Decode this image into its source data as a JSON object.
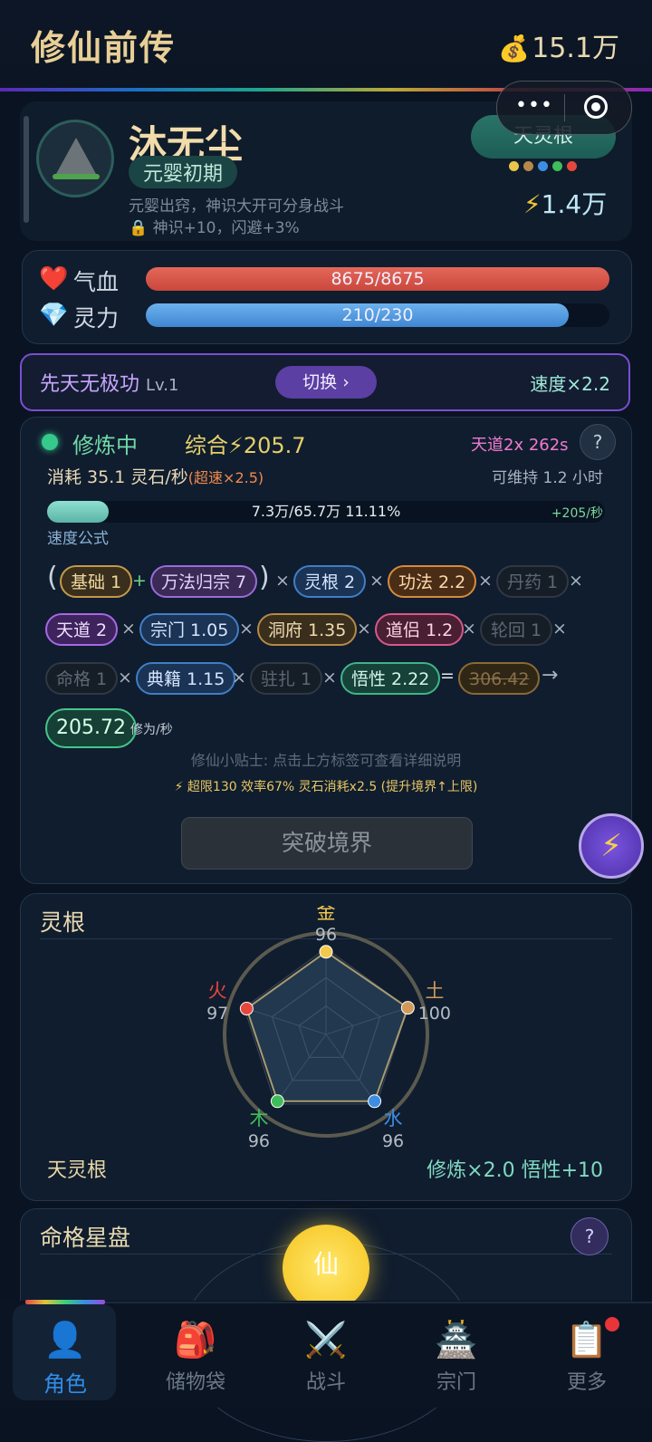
{
  "header": {
    "title": "修仙前传",
    "coins_icon": "money-bag-icon",
    "coins": "15.1万"
  },
  "profile": {
    "name": "沐无尘",
    "realm": "元婴初期",
    "realm_desc": "元婴出窍，神识大开可分身战斗",
    "realm_bonus": "神识+10，闪避+3%",
    "root_button": "天灵根",
    "root_dot_colors": [
      "#e8c64a",
      "#b7884a",
      "#3d8de3",
      "#3fbd5a",
      "#e5473d"
    ],
    "power": "1.4万"
  },
  "stats": {
    "hp_label": "气血",
    "hp_text": "8675/8675",
    "hp_fraction": 1.0,
    "mp_label": "灵力",
    "mp_text": "210/230",
    "mp_fraction": 0.913
  },
  "technique": {
    "name": "先天无极功",
    "level": "Lv.1",
    "switch_label": "切换 ›",
    "speed": "速度×2.2"
  },
  "cultivation": {
    "status": "修炼中",
    "total": "综合⚡205.7",
    "heaven_timer": "天道2x 262s",
    "help": "?",
    "consume": "消耗 35.1 灵石/秒",
    "overspeed": "(超速×2.5)",
    "sustain": "可维持 1.2 小时",
    "progress_text": "7.3万/65.7万  11.11%",
    "progress_fraction": 0.1111,
    "progress_rate": "+205/秒",
    "formula_label": "速度公式",
    "tags": {
      "base": "基础 1",
      "wanfa": "万法归宗 7",
      "root": "灵根 2",
      "gongfa": "功法 2.2",
      "danyao": "丹药 1",
      "tiandao": "天道 2",
      "zongmen": "宗门 1.05",
      "dongfu": "洞府 1.35",
      "daolv": "道侣 1.2",
      "lunhui": "轮回 1",
      "mingge": "命格 1",
      "dianji": "典籍 1.15",
      "zhuzha": "驻扎 1",
      "wuxing": "悟性 2.22",
      "old": "306.42",
      "result": "205.72"
    },
    "ops": {
      "plus": "+",
      "times": "×",
      "eq": "=",
      "arrow": "→",
      "lparen": "(",
      "rparen": ")"
    },
    "rate_unit": "修为/秒",
    "tip": "修仙小贴士: 点击上方标签可查看详细说明",
    "warning": "⚡ 超限130 效率67% 灵石消耗x2.5 (提升境界↑上限)",
    "breakthrough": "突破境界"
  },
  "spirit_roots": {
    "title": "灵根",
    "type": "天灵根",
    "bonus": "修炼×2.0  悟性+10",
    "elements": [
      {
        "name": "金",
        "value": 96,
        "color": "#f2c94c"
      },
      {
        "name": "土",
        "value": 100,
        "color": "#d19a5a"
      },
      {
        "name": "水",
        "value": 96,
        "color": "#3d8de3"
      },
      {
        "name": "木",
        "value": 96,
        "color": "#3fbd5a"
      },
      {
        "name": "火",
        "value": 97,
        "color": "#e5473d"
      }
    ]
  },
  "star_disk": {
    "title": "命格星盘",
    "help": "?",
    "center": "仙"
  },
  "tabs": [
    {
      "label": "角色",
      "icon": "person-icon"
    },
    {
      "label": "储物袋",
      "icon": "backpack-icon"
    },
    {
      "label": "战斗",
      "icon": "crossed-swords-icon"
    },
    {
      "label": "宗门",
      "icon": "pagoda-icon"
    },
    {
      "label": "更多",
      "icon": "clipboard-icon"
    }
  ]
}
